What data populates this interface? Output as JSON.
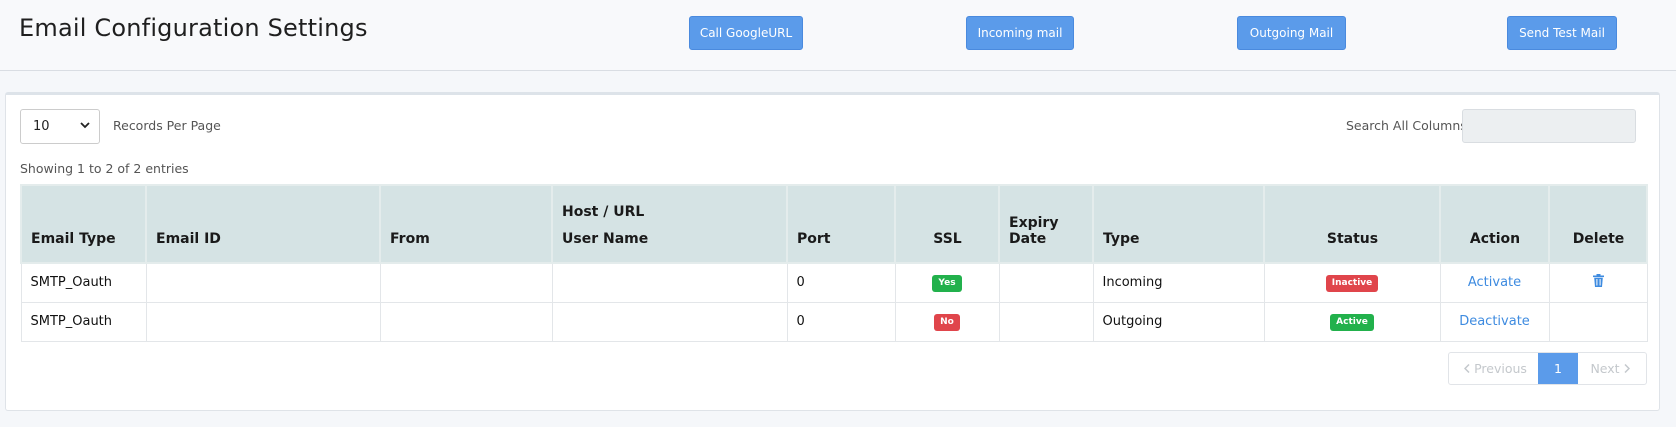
{
  "header": {
    "title": "Email Configuration Settings",
    "buttons": [
      "Call GoogleURL",
      "Incoming mail",
      "Outgoing Mail",
      "Send Test Mail"
    ]
  },
  "controls": {
    "page_length": "10",
    "page_length_label": "Records Per Page",
    "search_label": "Search All Columns",
    "search_value": ""
  },
  "info": "Showing 1 to 2 of 2 entries",
  "table": {
    "headers": [
      "Email Type",
      "Email ID",
      "From",
      "Host / URL",
      "User Name",
      "Port",
      "SSL",
      "Expiry Date",
      "Type",
      "Status",
      "Action",
      "Delete"
    ],
    "rows": [
      {
        "email_type": "SMTP_Oauth",
        "email_id": "",
        "from": "",
        "host": "",
        "port": "0",
        "ssl": "Yes",
        "expiry": "",
        "type": "Incoming",
        "status": "Inactive",
        "action": "Activate",
        "delete_icon": "trash-icon"
      },
      {
        "email_type": "SMTP_Oauth",
        "email_id": "",
        "from": "",
        "host": "",
        "port": "0",
        "ssl": "No",
        "expiry": "",
        "type": "Outgoing",
        "status": "Active",
        "action": "Deactivate",
        "delete_icon": ""
      }
    ]
  },
  "pagination": {
    "previous": "Previous",
    "current": "1",
    "next": "Next"
  },
  "colors": {
    "primary": "#5b9bea",
    "success": "#22b14c",
    "danger": "#e0454b",
    "header_bg": "#d5e3e4",
    "link": "#3e8be0"
  }
}
